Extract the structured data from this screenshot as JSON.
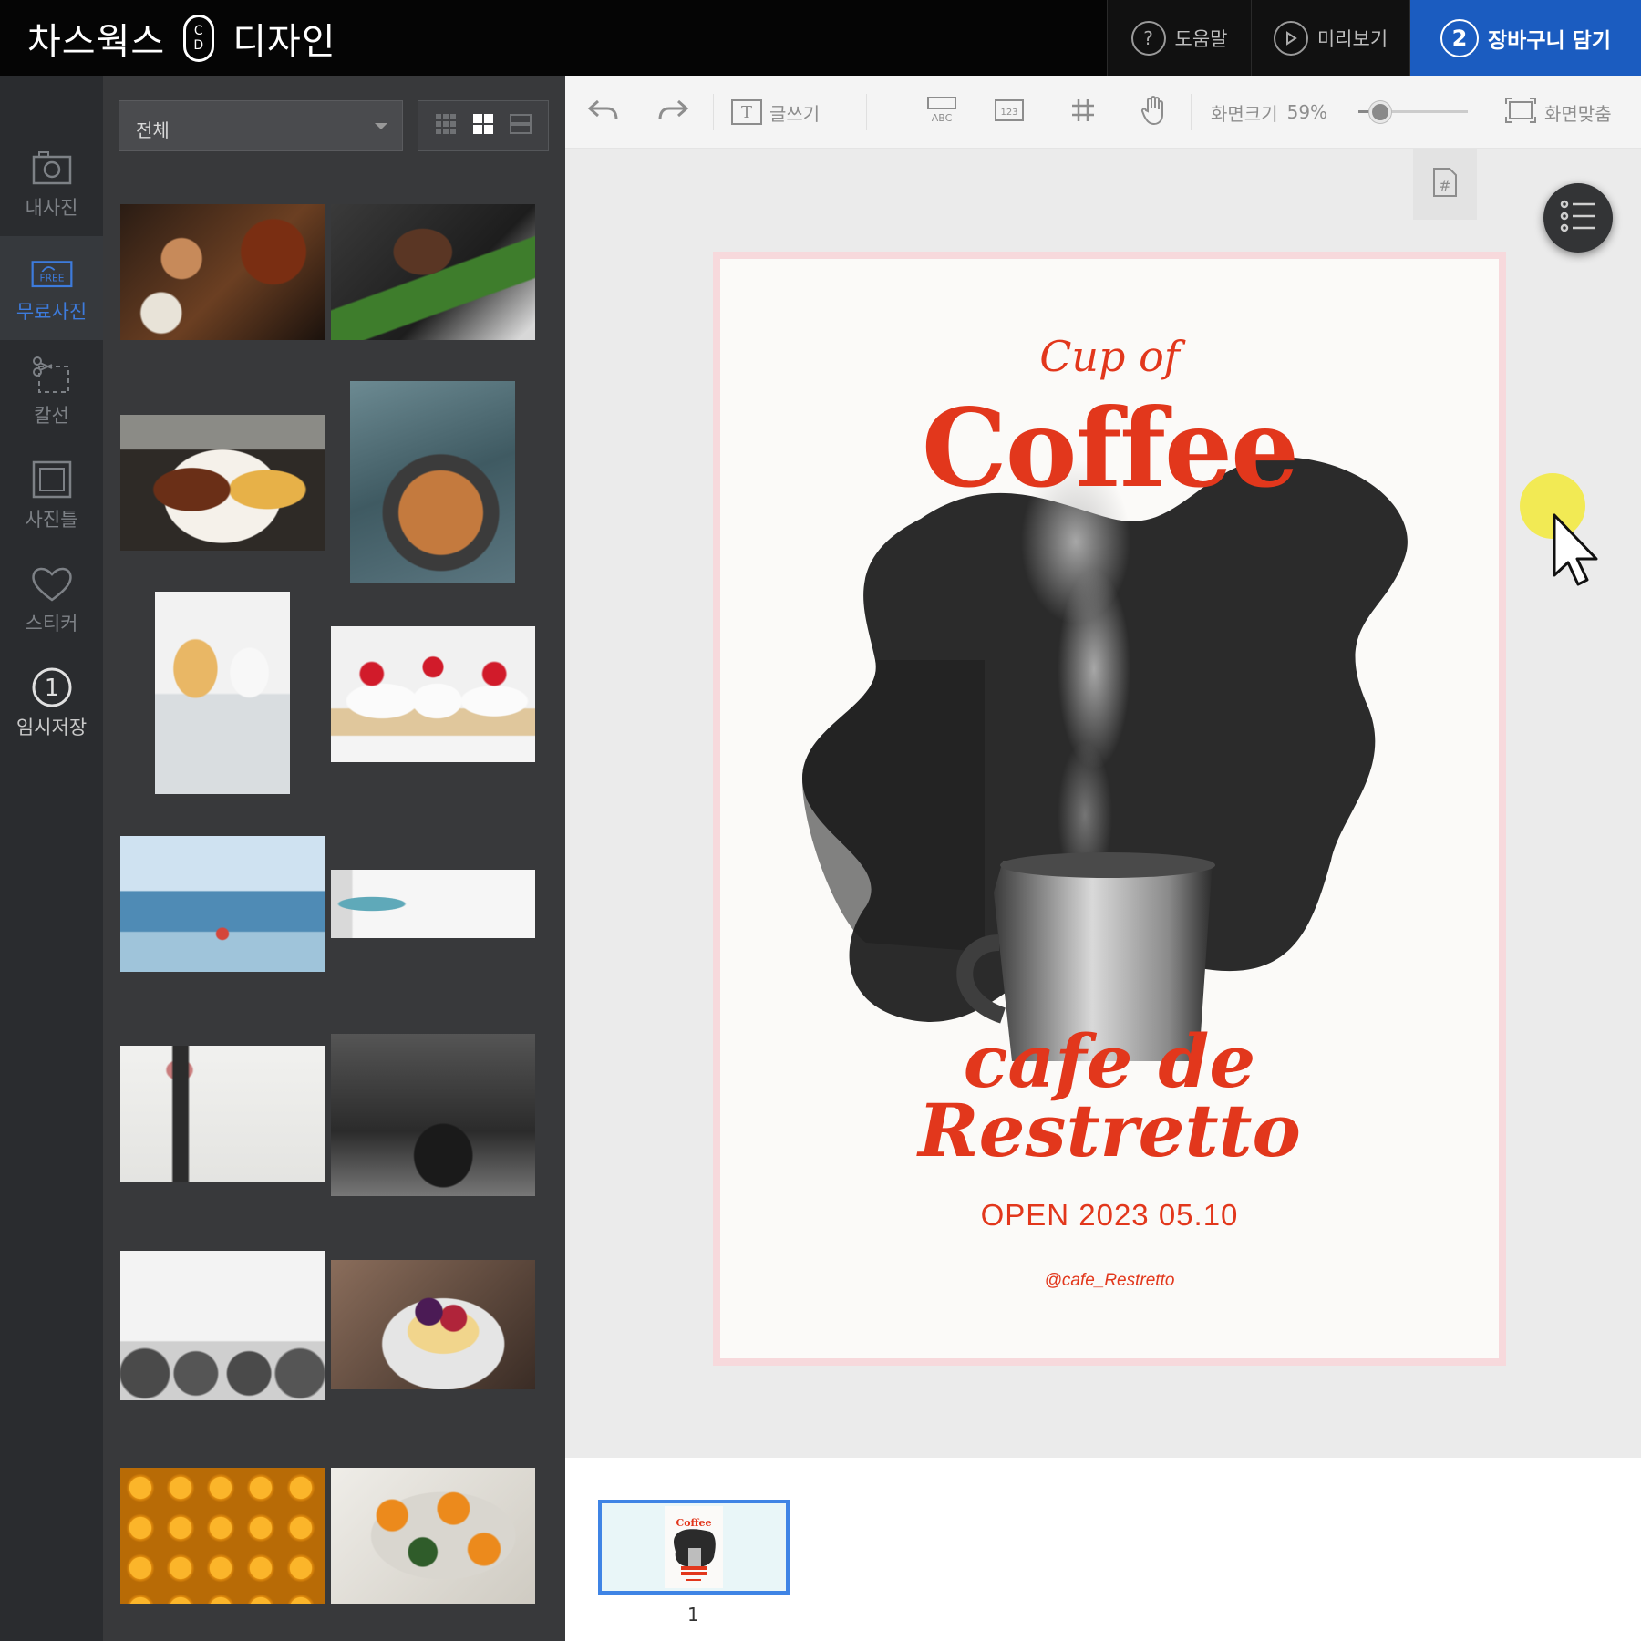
{
  "header": {
    "brand_left": "차스웍스",
    "brand_logo_top": "C",
    "brand_logo_bottom": "D",
    "brand_right": "디자인",
    "help_label": "도움말",
    "help_icon_glyph": "?",
    "preview_label": "미리보기",
    "cart_label": "장바구니 담기",
    "cart_step": "2"
  },
  "rail": {
    "items": [
      {
        "label": "내사진",
        "icon": "camera-icon"
      },
      {
        "label": "무료사진",
        "icon": "free-photo-icon",
        "badge": "FREE"
      },
      {
        "label": "칼선",
        "icon": "scissors-icon"
      },
      {
        "label": "사진틀",
        "icon": "frame-icon"
      },
      {
        "label": "스티커",
        "icon": "heart-icon"
      },
      {
        "label": "임시저장",
        "icon": "temp-save-icon",
        "badge": "1"
      }
    ]
  },
  "panel": {
    "category_value": "전체",
    "photos": [
      {
        "name": "steak-board"
      },
      {
        "name": "steak-greenbeans"
      },
      {
        "name": "ribs-fries"
      },
      {
        "name": "cookies-plate"
      },
      {
        "name": "lemon-cake"
      },
      {
        "name": "raspberry-cupcakes"
      },
      {
        "name": "beach-person"
      },
      {
        "name": "yoga-mat"
      },
      {
        "name": "runner-legs"
      },
      {
        "name": "gym-barbell"
      },
      {
        "name": "dumbbells"
      },
      {
        "name": "berry-cheesecake"
      },
      {
        "name": "oranges"
      },
      {
        "name": "tangerines"
      }
    ]
  },
  "toolbar": {
    "write_label": "글쓰기",
    "write_icon_glyph": "T",
    "abc_label": "ABC",
    "num_label": "123",
    "zoom_label": "화면크기",
    "zoom_value": "59%",
    "zoom_fraction": 0.2,
    "fit_label": "화면맞춤"
  },
  "canvas": {
    "page_number_glyph": "#",
    "poster": {
      "line1": "Cup of",
      "line2": "Coffee",
      "line3": "cafe de",
      "line4": "Restretto",
      "line5": "OPEN 2023 05.10",
      "line6": "@cafe_Restretto"
    },
    "accent_color": "#e2371c"
  },
  "strip": {
    "page_label": "1",
    "thumb_title": "Coffee"
  }
}
